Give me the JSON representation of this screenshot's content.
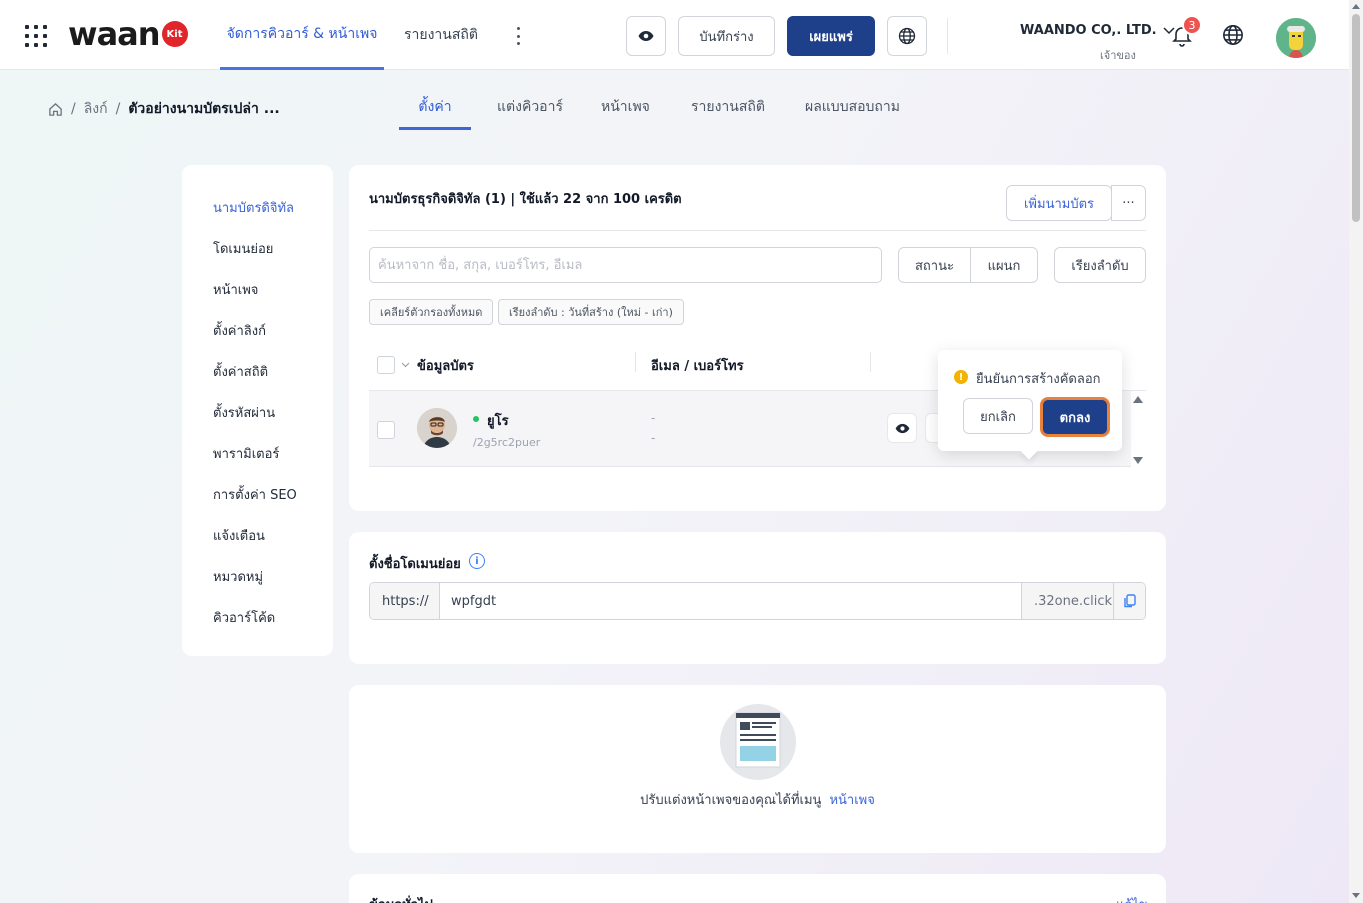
{
  "header": {
    "logo_text": "waan",
    "logo_badge": "Kit",
    "nav_tabs": [
      {
        "label": "จัดการคิวอาร์ & หน้าเพจ",
        "active": true
      },
      {
        "label": "รายงานสถิติ",
        "active": false
      }
    ],
    "draft_label": "บันทึกร่าง",
    "publish_label": "เผยแพร่",
    "company_name": "WAANDO CO,. LTD.",
    "company_role": "เจ้าของ",
    "notification_count": "3"
  },
  "breadcrumb": {
    "link": "ลิงก์",
    "current": "ตัวอย่างนามบัตรเปล่า ..."
  },
  "subtabs": [
    {
      "label": "ตั้งค่า",
      "active": true
    },
    {
      "label": "แต่งคิวอาร์",
      "active": false
    },
    {
      "label": "หน้าเพจ",
      "active": false
    },
    {
      "label": "รายงานสถิติ",
      "active": false
    },
    {
      "label": "ผลแบบสอบถาม",
      "active": false
    }
  ],
  "sidebar": {
    "items": [
      {
        "label": "นามบัตรดิจิทัล",
        "active": true
      },
      {
        "label": "โดเมนย่อย",
        "active": false
      },
      {
        "label": "หน้าเพจ",
        "active": false
      },
      {
        "label": "ตั้งค่าลิงก์",
        "active": false
      },
      {
        "label": "ตั้งค่าสถิติ",
        "active": false
      },
      {
        "label": "ตั้งรหัสผ่าน",
        "active": false
      },
      {
        "label": "พารามิเตอร์",
        "active": false
      },
      {
        "label": "การตั้งค่า SEO",
        "active": false
      },
      {
        "label": "แจ้งเตือน",
        "active": false
      },
      {
        "label": "หมวดหมู่",
        "active": false
      },
      {
        "label": "คิวอาร์โค้ด",
        "active": false
      }
    ]
  },
  "cards_panel": {
    "title": "นามบัตรธุรกิจดิจิทัล (1) | ใช้แล้ว 22 จาก 100 เครดิต",
    "add_label": "เพิ่มนามบัตร",
    "more_label": "···",
    "search_placeholder": "ค้นหาจาก ชื่อ, สกุล, เบอร์โทร, อีเมล",
    "search_value": "",
    "filter_status": "สถานะ",
    "filter_department": "แผนก",
    "sort_label": "เรียงลำดับ",
    "chip_clear": "เคลียร์ตัวกรองทั้งหมด",
    "chip_sort": "เรียงลำดับ : วันที่สร้าง (ใหม่ - เก่า)",
    "columns": [
      "ข้อมูลบัตร",
      "อีเมล / เบอร์โทร"
    ],
    "rows": [
      {
        "name": "ยูโร",
        "slug": "/2g5rc2puer",
        "email": "-",
        "phone": "-"
      }
    ]
  },
  "popover": {
    "message": "ยืนยันการสร้างคัดลอก",
    "cancel_label": "ยกเลิก",
    "ok_label": "ตกลง"
  },
  "domain_panel": {
    "title": "ตั้งชื่อโดเมนย่อย",
    "prefix": "https://",
    "value": "wpfgdt",
    "suffix": ".32one.click"
  },
  "page_panel": {
    "hint": "ปรับแต่งหน้าเพจของคุณได้ที่เมนู",
    "link": "หน้าเพจ"
  },
  "general_panel": {
    "title": "ข้อมูลทั่วไป",
    "edit_label": "แก้ไข"
  },
  "colors": {
    "primary": "#1e3f8a",
    "accent_blue": "#3b63d6",
    "focus_ring": "#e9823e",
    "status_online": "#22c55e",
    "badge_red": "#ef5350"
  }
}
